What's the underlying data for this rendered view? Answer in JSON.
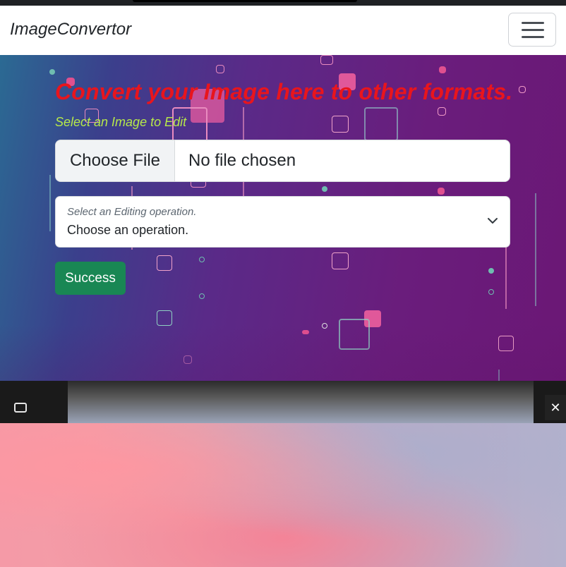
{
  "navbar": {
    "brand": "ImageConvertor",
    "toggle_icon": "hamburger-menu-icon"
  },
  "hero": {
    "headline": "Convert your Image here to other formats.",
    "subheading": "Select an Image to Edit",
    "file_input": {
      "button_label": "Choose File",
      "status": "No file chosen"
    },
    "operation_select": {
      "label": "Select an Editing operation.",
      "selected": "Choose an operation.",
      "icon": "chevron-down-icon"
    },
    "submit_label": "Success"
  },
  "overlay": {
    "pip_icon": "picture-in-picture-icon",
    "close_icon": "close-icon",
    "close_glyph": "✕"
  },
  "colors": {
    "headline": "#e8151d",
    "subheading": "#b6e84a",
    "success": "#198754",
    "hero_start": "#2b6a93",
    "hero_end": "#6b1775"
  }
}
